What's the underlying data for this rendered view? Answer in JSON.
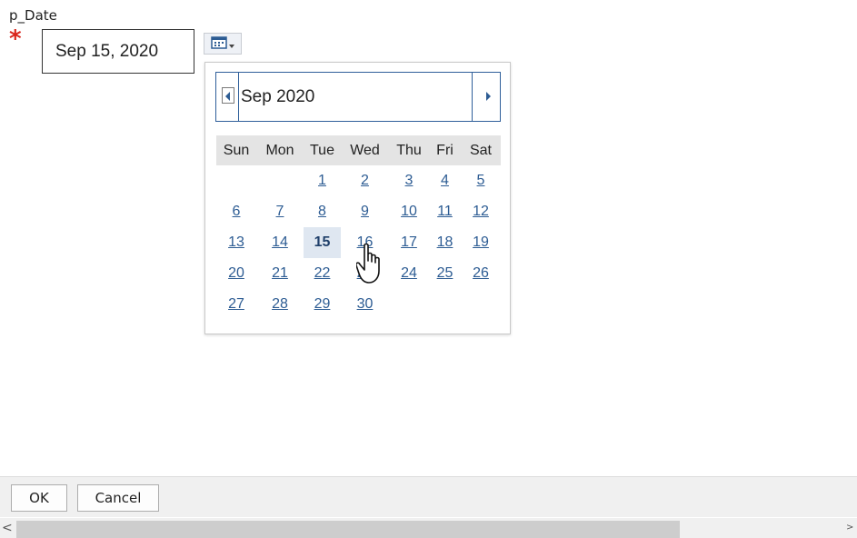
{
  "param": {
    "label": "p_Date",
    "required_marker": "*",
    "value": "Sep 15, 2020"
  },
  "calendar": {
    "month_label": "Sep 2020",
    "days_of_week": [
      "Sun",
      "Mon",
      "Tue",
      "Wed",
      "Thu",
      "Fri",
      "Sat"
    ],
    "weeks": [
      [
        "",
        "",
        "1",
        "2",
        "3",
        "4",
        "5"
      ],
      [
        "6",
        "7",
        "8",
        "9",
        "10",
        "11",
        "12"
      ],
      [
        "13",
        "14",
        "15",
        "16",
        "17",
        "18",
        "19"
      ],
      [
        "20",
        "21",
        "22",
        "23",
        "24",
        "25",
        "26"
      ],
      [
        "27",
        "28",
        "29",
        "30",
        "",
        "",
        ""
      ]
    ],
    "selected_day": "15",
    "hovered_day": "16"
  },
  "footer": {
    "ok_label": "OK",
    "cancel_label": "Cancel"
  },
  "scrollbar": {
    "left_arrow": "<",
    "right_arrow": ">"
  },
  "colors": {
    "accent": "#2d5c93",
    "required": "#d9251c",
    "selected_bg": "#dfe7f1"
  }
}
